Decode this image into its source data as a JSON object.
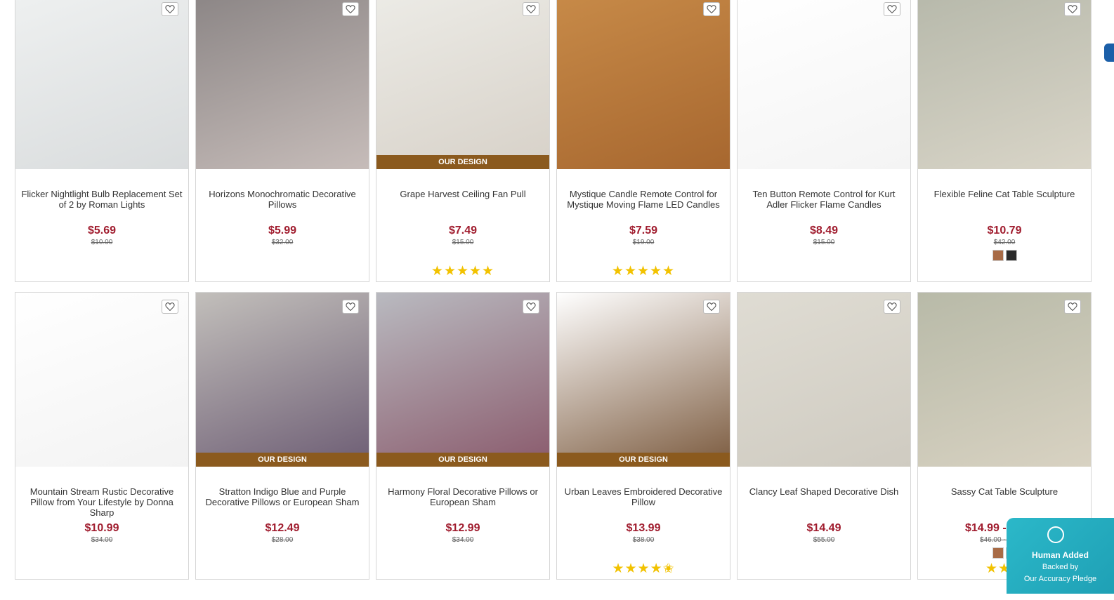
{
  "products": [
    {
      "title": "Flicker Nightlight Bulb Replacement Set of 2 by Roman Lights",
      "price": "$5.69",
      "was": "$10.00",
      "badge": "",
      "stars": "",
      "swatches": [],
      "img_colors": [
        "#eef0f0",
        "#d9dcdd"
      ]
    },
    {
      "title": "Horizons Monochromatic Decorative Pillows",
      "price": "$5.99",
      "was": "$32.00",
      "badge": "",
      "stars": "",
      "swatches": [],
      "img_colors": [
        "#8c8686",
        "#c6bcb9"
      ]
    },
    {
      "title": "Grape Harvest Ceiling Fan Pull",
      "price": "$7.49",
      "was": "$15.00",
      "badge": "OUR DESIGN",
      "stars": "★★★★★",
      "swatches": [],
      "img_colors": [
        "#ecebe6",
        "#d7d1c8"
      ]
    },
    {
      "title": "Mystique Candle Remote Control for Mystique Moving Flame LED Candles",
      "price": "$7.59",
      "was": "$19.00",
      "badge": "",
      "stars": "★★★★★",
      "swatches": [],
      "img_colors": [
        "#c78a48",
        "#a7672f"
      ]
    },
    {
      "title": "Ten Button Remote Control for Kurt Adler Flicker Flame Candles",
      "price": "$8.49",
      "was": "$15.00",
      "badge": "",
      "stars": "",
      "swatches": [],
      "img_colors": [
        "#ffffff",
        "#f4f4f4"
      ]
    },
    {
      "title": "Flexible Feline Cat Table Sculpture",
      "price": "$10.79",
      "was": "$42.00",
      "badge": "",
      "stars": "",
      "swatches": [
        "#a86b46",
        "#2b2b2b"
      ],
      "img_colors": [
        "#b7b9ab",
        "#d9d5c8"
      ]
    },
    {
      "title": "Mountain Stream Rustic Decorative Pillow from Your Lifestyle by Donna Sharp",
      "price": "$10.99",
      "was": "$34.00",
      "badge": "",
      "stars": "",
      "swatches": [],
      "img_colors": [
        "#ffffff",
        "#f3f3f3"
      ]
    },
    {
      "title": "Stratton Indigo Blue and Purple Decorative Pillows or European Sham",
      "price": "$12.49",
      "was": "$28.00",
      "badge": "OUR DESIGN",
      "stars": "",
      "swatches": [],
      "img_colors": [
        "#c2bfbb",
        "#6d5d74"
      ]
    },
    {
      "title": "Harmony Floral Decorative Pillows or European Sham",
      "price": "$12.99",
      "was": "$34.00",
      "badge": "OUR DESIGN",
      "stars": "",
      "swatches": [],
      "img_colors": [
        "#b9bac0",
        "#8a5a6c"
      ]
    },
    {
      "title": "Urban Leaves Embroidered Decorative Pillow",
      "price": "$13.99",
      "was": "$38.00",
      "badge": "OUR DESIGN",
      "stars": "★★★★✬",
      "swatches": [],
      "img_colors": [
        "#ffffff",
        "#7b5a3e"
      ]
    },
    {
      "title": "Clancy Leaf Shaped Decorative Dish",
      "price": "$14.49",
      "was": "$55.00",
      "badge": "",
      "stars": "",
      "swatches": [],
      "img_colors": [
        "#dfdcd3",
        "#cfcbc1"
      ]
    },
    {
      "title": "Sassy Cat Table Sculpture",
      "price": "$14.99 - $15.99",
      "was": "$46.00 - $46.00",
      "badge": "",
      "stars": "★★★",
      "swatches": [
        "#a86b46",
        "#2b2b2b"
      ],
      "img_colors": [
        "#b8baa8",
        "#d8d2c2"
      ]
    }
  ],
  "wishlist_icon": "heart-outline-icon",
  "trust_badge": {
    "title": "Human Added",
    "line1": "Backed by",
    "line2": "Our Accuracy Pledge"
  }
}
